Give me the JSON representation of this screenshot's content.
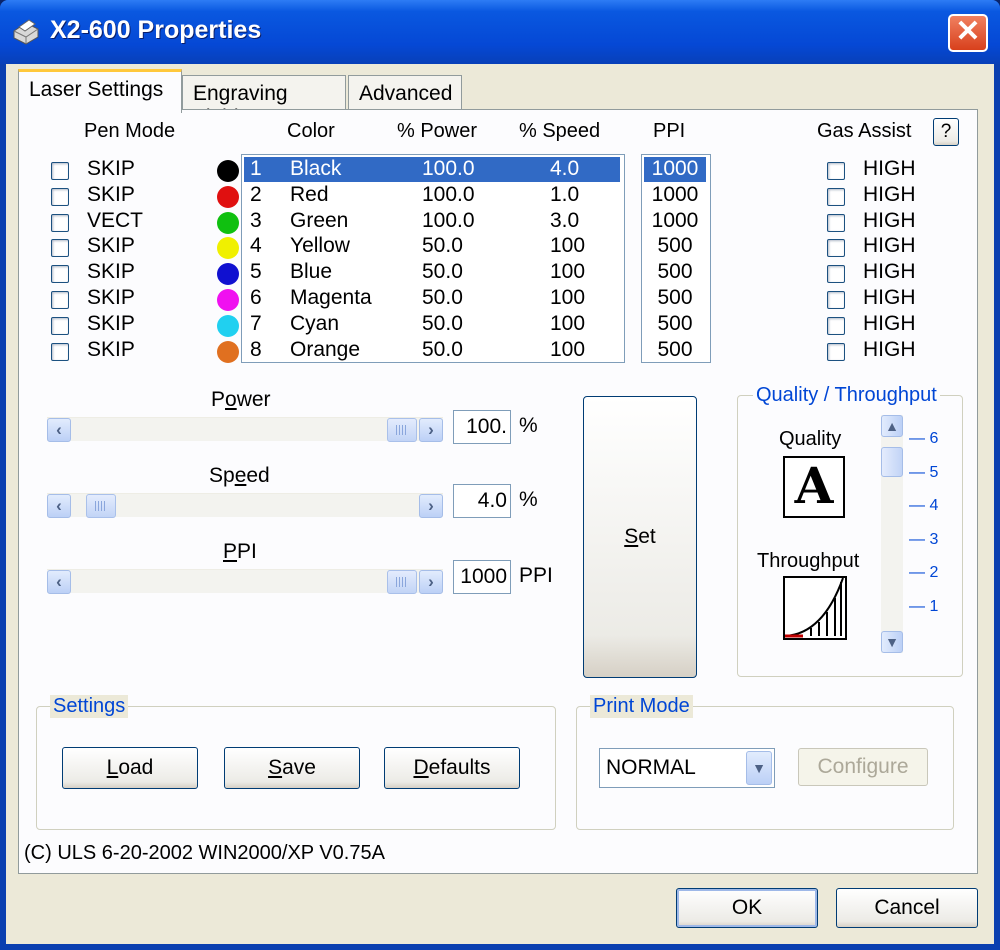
{
  "window": {
    "title": "X2-600 Properties",
    "close_label": "✕"
  },
  "tabs": [
    "Laser Settings",
    "Engraving Field",
    "Advanced"
  ],
  "headers": {
    "pen_mode": "Pen Mode",
    "color": "Color",
    "power": "% Power",
    "speed": "% Speed",
    "ppi": "PPI",
    "gas_assist": "Gas Assist",
    "help": "?"
  },
  "pens": [
    {
      "mode": "SKIP",
      "num": "1",
      "color": "Black",
      "power": "100.0",
      "speed": "4.0",
      "ppi": "1000",
      "gas": "HIGH",
      "swatch": "#000000"
    },
    {
      "mode": "SKIP",
      "num": "2",
      "color": "Red",
      "power": "100.0",
      "speed": "1.0",
      "ppi": "1000",
      "gas": "HIGH",
      "swatch": "#e01010"
    },
    {
      "mode": "VECT",
      "num": "3",
      "color": "Green",
      "power": "100.0",
      "speed": "3.0",
      "ppi": "1000",
      "gas": "HIGH",
      "swatch": "#10c010"
    },
    {
      "mode": "SKIP",
      "num": "4",
      "color": "Yellow",
      "power": "50.0",
      "speed": "100",
      "ppi": "500",
      "gas": "HIGH",
      "swatch": "#f0f000"
    },
    {
      "mode": "SKIP",
      "num": "5",
      "color": "Blue",
      "power": "50.0",
      "speed": "100",
      "ppi": "500",
      "gas": "HIGH",
      "swatch": "#1010d0"
    },
    {
      "mode": "SKIP",
      "num": "6",
      "color": "Magenta",
      "power": "50.0",
      "speed": "100",
      "ppi": "500",
      "gas": "HIGH",
      "swatch": "#f010f0"
    },
    {
      "mode": "SKIP",
      "num": "7",
      "color": "Cyan",
      "power": "50.0",
      "speed": "100",
      "ppi": "500",
      "gas": "HIGH",
      "swatch": "#20d0f0"
    },
    {
      "mode": "SKIP",
      "num": "8",
      "color": "Orange",
      "power": "50.0",
      "speed": "100",
      "ppi": "500",
      "gas": "HIGH",
      "swatch": "#e07020"
    }
  ],
  "sliders": {
    "power": {
      "label_pre": "P",
      "label_ul": "o",
      "label_post": "wer",
      "value": "100.",
      "unit": "%",
      "level": 1.0
    },
    "speed": {
      "label_pre": "Sp",
      "label_ul": "e",
      "label_post": "ed",
      "value": "4.0",
      "unit": "%",
      "level": 0.04
    },
    "ppi": {
      "label_pre": "",
      "label_ul": "P",
      "label_post": "PI",
      "value": "1000",
      "unit": "PPI",
      "level": 1.0
    }
  },
  "set_button": {
    "ul": "S",
    "rest": "et"
  },
  "quality": {
    "group_title": "Quality / Throughput",
    "quality_label": "Quality",
    "quality_glyph": "A",
    "throughput_label": "Throughput",
    "ticks": [
      "— 6",
      "— 5",
      "— 4",
      "— 3",
      "— 2",
      "— 1"
    ],
    "current_level": 5
  },
  "settings": {
    "group_title": "Settings",
    "load": {
      "ul": "L",
      "rest": "oad"
    },
    "save": {
      "ul": "S",
      "rest": "ave"
    },
    "defaults": {
      "ul": "D",
      "rest": "efaults"
    }
  },
  "print_mode": {
    "group_title": "Print Mode",
    "value": "NORMAL",
    "configure": "Configure"
  },
  "footer": "(C) ULS 6-20-2002 WIN2000/XP V0.75A",
  "dialog": {
    "ok": "OK",
    "cancel": "Cancel"
  },
  "colors": {
    "selection": "#316ac5",
    "accent": "#0046d5",
    "titlebar": "#0548d5"
  }
}
